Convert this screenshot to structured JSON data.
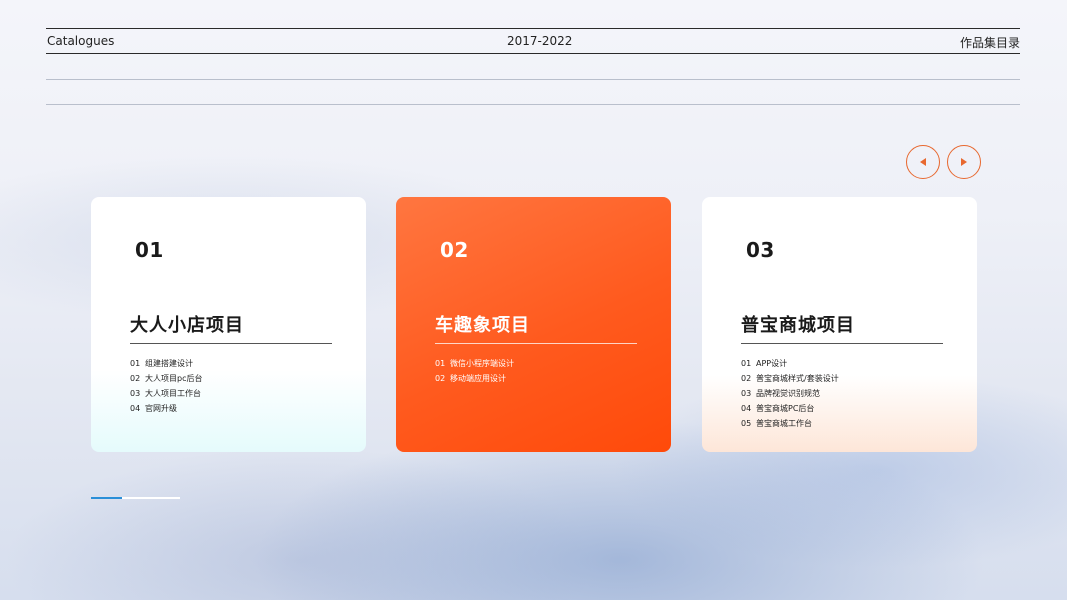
{
  "header": {
    "left_label": "Catalogues",
    "center_label": "2017-2022",
    "right_label": "作品集目录"
  },
  "nav": {
    "prev_icon": "caret-left-icon",
    "next_icon": "caret-right-icon"
  },
  "cards": [
    {
      "number": "01",
      "title": "大人小店项目",
      "items": [
        {
          "index": "01",
          "label": "组建搭建设计"
        },
        {
          "index": "02",
          "label": "大人项目pc后台"
        },
        {
          "index": "03",
          "label": "大人项目工作台"
        },
        {
          "index": "04",
          "label": "官网升级"
        }
      ]
    },
    {
      "number": "02",
      "title": "车趣象项目",
      "items": [
        {
          "index": "01",
          "label": "微信小程序端设计"
        },
        {
          "index": "02",
          "label": "移动端应用设计"
        }
      ]
    },
    {
      "number": "03",
      "title": "普宝商城项目",
      "items": [
        {
          "index": "01",
          "label": "APP设计"
        },
        {
          "index": "02",
          "label": "普宝商城样式/套装设计"
        },
        {
          "index": "03",
          "label": "品牌视觉识别规范"
        },
        {
          "index": "04",
          "label": "普宝商城PC后台"
        },
        {
          "index": "05",
          "label": "普宝商城工作台"
        }
      ]
    }
  ],
  "progress": {
    "fraction": 0.35
  },
  "colors": {
    "accent": "#ff5a1e",
    "nav_border": "#e8682f",
    "progress_fill": "#2a8fd8"
  }
}
